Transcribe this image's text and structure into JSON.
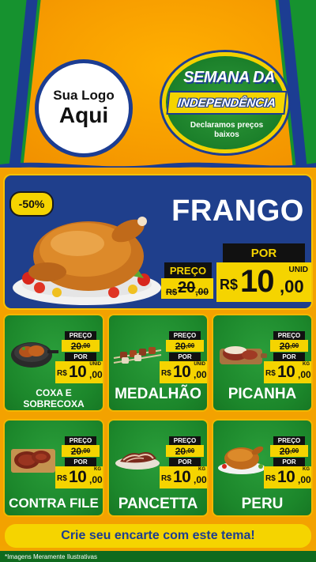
{
  "header": {
    "logo_line1": "Sua Logo",
    "logo_line2": "Aqui",
    "badge_top": "SEMANA DA",
    "badge_ribbon": "INDEPENDÊNCIA",
    "badge_sub": "Declaramos preços baixos"
  },
  "hero": {
    "discount": "-50%",
    "title": "FRANGO",
    "preco_label": "PREÇO",
    "old_currency": "R$",
    "old_int": "20",
    "old_dec": ",00",
    "por_label": "POR",
    "new_currency": "R$",
    "new_int": "10",
    "new_dec": ",00",
    "unit": "UNID",
    "image_icon": "roast-chicken-plate"
  },
  "products": [
    {
      "name": "COXA E SOBRECOXA",
      "preco_label": "PREÇO",
      "old_int": "20",
      "old_dec": ",00",
      "por_label": "POR",
      "currency": "R$",
      "new_int": "10",
      "new_dec": ",00",
      "unit": "UNID",
      "icon": "chicken-thigh-pan"
    },
    {
      "name": "MEDALHÃO",
      "preco_label": "PREÇO",
      "old_int": "20",
      "old_dec": ",00",
      "por_label": "POR",
      "currency": "R$",
      "new_int": "10",
      "new_dec": ",00",
      "unit": "UNID",
      "icon": "skewers"
    },
    {
      "name": "PICANHA",
      "preco_label": "PREÇO",
      "old_int": "20",
      "old_dec": ",00",
      "por_label": "POR",
      "currency": "R$",
      "new_int": "10",
      "new_dec": ",00",
      "unit": "KG",
      "icon": "picanha-board"
    },
    {
      "name": "CONTRA FILE",
      "preco_label": "PREÇO",
      "old_int": "20",
      "old_dec": ",00",
      "por_label": "POR",
      "currency": "R$",
      "new_int": "10",
      "new_dec": ",00",
      "unit": "KG",
      "icon": "steaks-board"
    },
    {
      "name": "PANCETTA",
      "preco_label": "PREÇO",
      "old_int": "20",
      "old_dec": ",00",
      "por_label": "POR",
      "currency": "R$",
      "new_int": "10",
      "new_dec": ",00",
      "unit": "KG",
      "icon": "pancetta-slices"
    },
    {
      "name": "PERU",
      "preco_label": "PREÇO",
      "old_int": "20",
      "old_dec": ",00",
      "por_label": "POR",
      "currency": "R$",
      "new_int": "10",
      "new_dec": ",00",
      "unit": "KG",
      "icon": "roast-turkey"
    }
  ],
  "cta": "Crie seu encarte com este tema!",
  "footer_note": "*Imagens Meramente Ilustrativas",
  "colors": {
    "green": "#1c872b",
    "blue": "#1f3f8c",
    "yellow": "#f5d400",
    "orange": "#f3a200"
  }
}
